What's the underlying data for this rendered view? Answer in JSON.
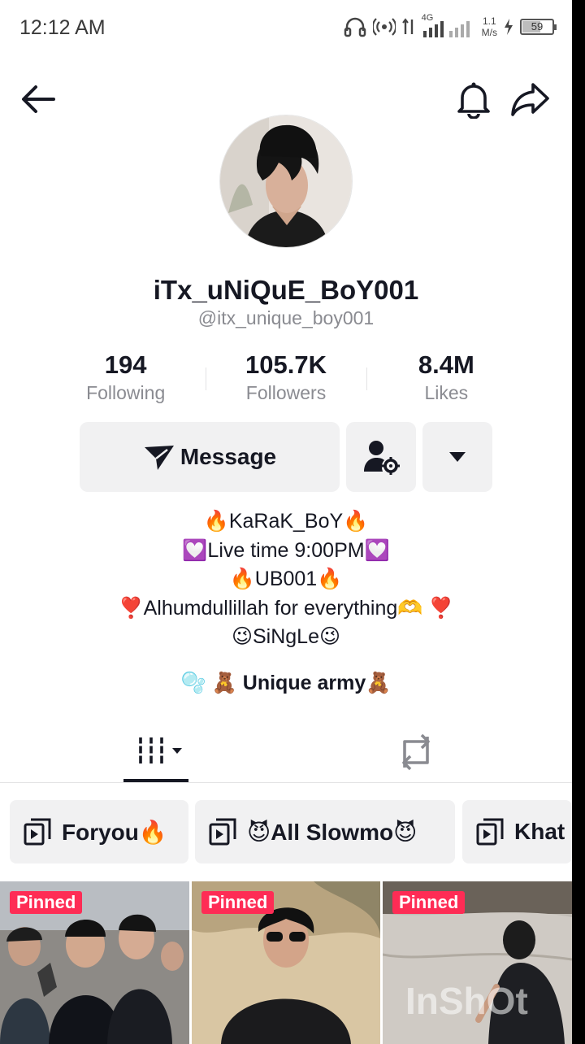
{
  "status_bar": {
    "time": "12:12 AM",
    "network": "4G",
    "speed_value": "1.1",
    "speed_unit": "M/s",
    "battery": "59",
    "battery_level": 0.59,
    "icons": [
      "headphones-icon",
      "hotspot-icon",
      "signal-icon",
      "charging-icon",
      "battery-icon"
    ]
  },
  "nav": {
    "back_icon": "arrow-left-icon",
    "bell_icon": "bell-icon",
    "share_icon": "share-icon"
  },
  "profile": {
    "display_name": "iTx_uNiQuE_BoY001",
    "username": "@itx_unique_boy001"
  },
  "stats": [
    {
      "value": "194",
      "label": "Following"
    },
    {
      "value": "105.7K",
      "label": "Followers"
    },
    {
      "value": "8.4M",
      "label": "Likes"
    }
  ],
  "actions": {
    "message_label": "Message",
    "message_icon": "send-icon",
    "follow_icon": "user-settings-icon",
    "more_icon": "caret-down-icon"
  },
  "bio": [
    "🔥KaRaK_BoY🔥",
    "💟Live time 9:00PM💟",
    "🔥UB001🔥",
    "❣️Alhumdullillah for everything🫶 ❣️",
    "😉SiNgLe😉"
  ],
  "link_line": "🫧 🧸 Unique army🧸",
  "tabs": {
    "videos_icon": "grid-icon",
    "repost_icon": "repost-icon"
  },
  "playlists": [
    {
      "label": "Foryou🔥"
    },
    {
      "label": "😈All Slowmo😈"
    },
    {
      "label": "Khat"
    }
  ],
  "videos": [
    {
      "badge": "Pinned"
    },
    {
      "badge": "Pinned"
    },
    {
      "badge": "Pinned",
      "watermark": "InShOt"
    }
  ],
  "colors": {
    "accent": "#fe2c55",
    "text": "#161823",
    "muted": "#8a8b91",
    "button_bg": "#f1f1f2"
  }
}
